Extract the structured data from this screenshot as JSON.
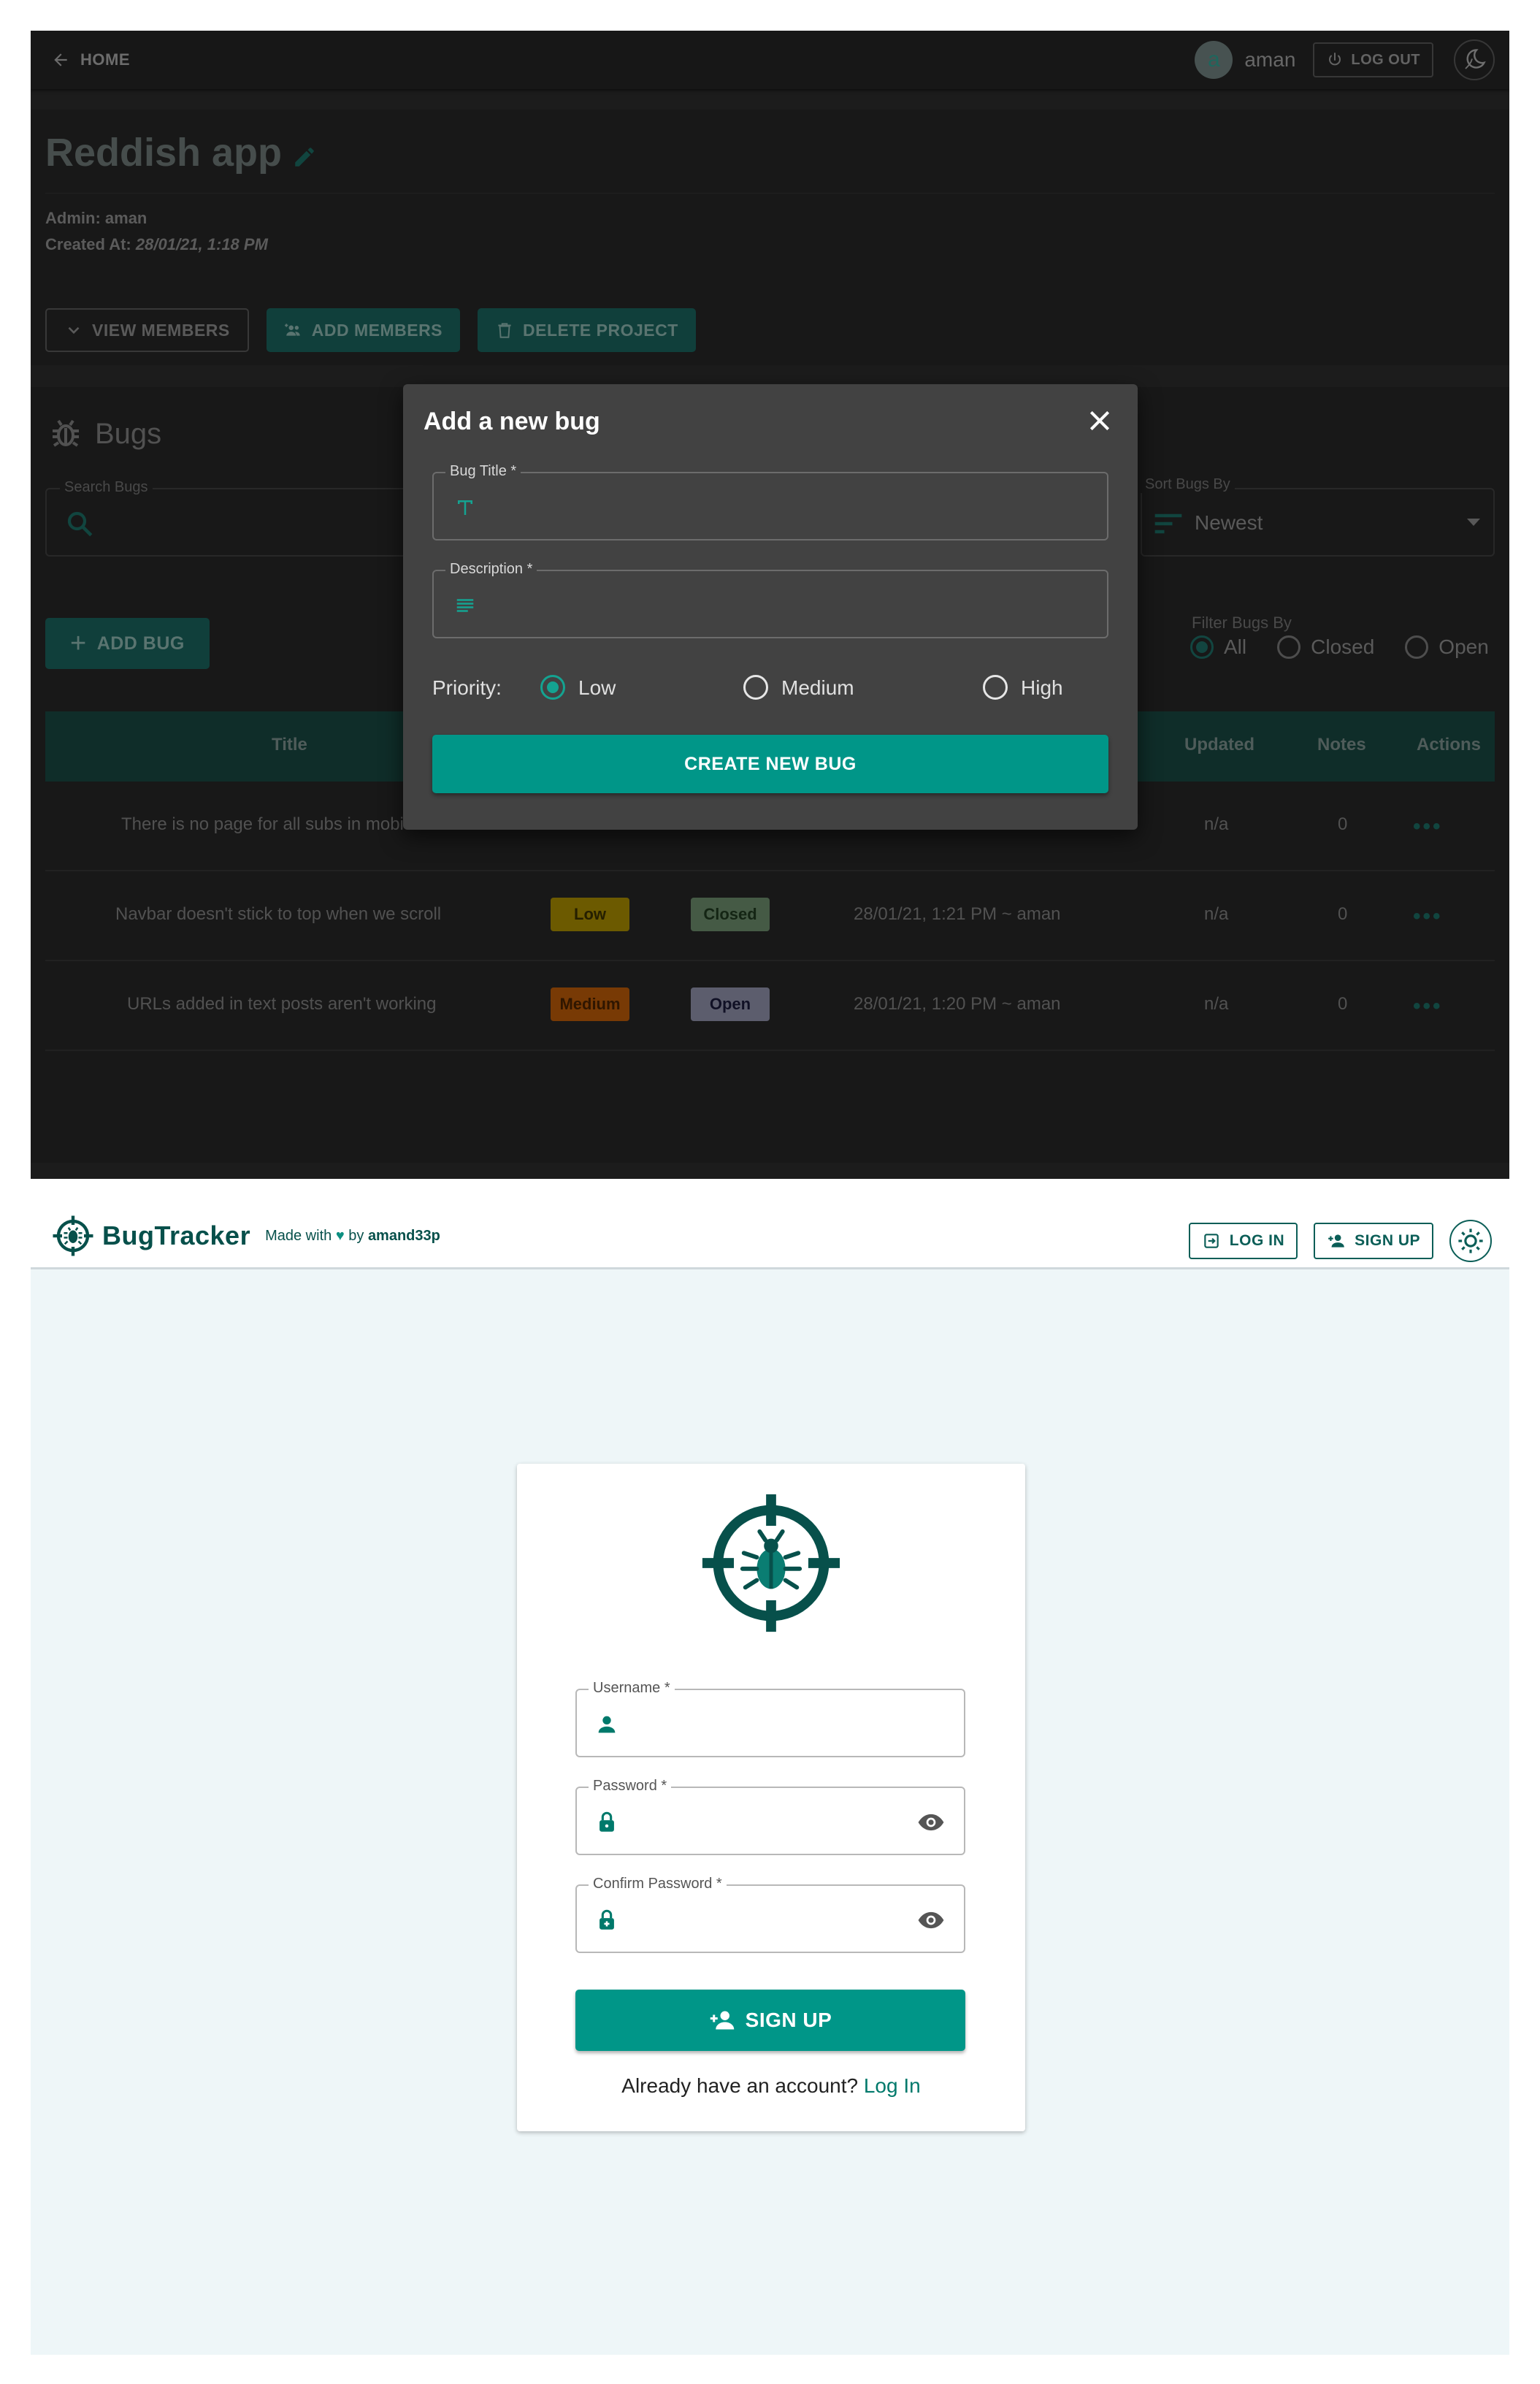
{
  "top_app": {
    "header": {
      "home_label": "HOME",
      "avatar_letter": "a",
      "username": "aman",
      "logout_label": "LOG OUT"
    },
    "project": {
      "title": "Reddish app",
      "admin_label": "Admin:",
      "admin_value": "aman",
      "created_label": "Created At:",
      "created_value": "28/01/21, 1:18 PM",
      "view_members_label": "VIEW MEMBERS",
      "add_members_label": "ADD MEMBERS",
      "delete_project_label": "DELETE PROJECT"
    },
    "bugs": {
      "title": "Bugs",
      "search_label": "Search Bugs",
      "sort_label": "Sort Bugs By",
      "sort_value": "Newest",
      "add_bug_label": "ADD BUG",
      "filter_label": "Filter Bugs By",
      "filter_options": [
        "All",
        "Closed",
        "Open"
      ],
      "filter_selected": "All",
      "columns": {
        "title": "Title",
        "updated": "Updated",
        "notes": "Notes",
        "actions": "Actions"
      },
      "rows": [
        {
          "title": "There is no page for all subs in mobi",
          "priority": "",
          "status": "",
          "created": "",
          "updated": "n/a",
          "notes": "0"
        },
        {
          "title": "Navbar doesn't stick to top when we scroll",
          "priority": "Low",
          "status": "Closed",
          "created": "28/01/21, 1:21 PM ~ aman",
          "updated": "n/a",
          "notes": "0"
        },
        {
          "title": "URLs added in text posts aren't working",
          "priority": "Medium",
          "status": "Open",
          "created": "28/01/21, 1:20 PM ~ aman",
          "updated": "n/a",
          "notes": "0"
        }
      ]
    },
    "dialog": {
      "title": "Add a new bug",
      "bug_title_label": "Bug Title *",
      "description_label": "Description *",
      "priority_label": "Priority:",
      "priority_options": [
        "Low",
        "Medium",
        "High"
      ],
      "priority_selected": "Low",
      "create_label": "CREATE NEW BUG"
    }
  },
  "signup_page": {
    "nav": {
      "brand": "BugTracker",
      "made_with": "Made with",
      "by": "by",
      "author": "amand33p",
      "login_label": "LOG IN",
      "signup_label": "SIGN UP"
    },
    "form": {
      "username_label": "Username *",
      "password_label": "Password *",
      "confirm_label": "Confirm Password *",
      "submit_label": "SIGN UP",
      "footer_text": "Already have an account?",
      "footer_link": "Log In"
    }
  },
  "colors": {
    "teal": "#009688",
    "dark_teal": "#0b5e57",
    "badge_low": "#a68a00",
    "badge_medium": "#b95a08",
    "badge_closed": "#6a8a6a",
    "badge_open": "#8e8fa8"
  }
}
